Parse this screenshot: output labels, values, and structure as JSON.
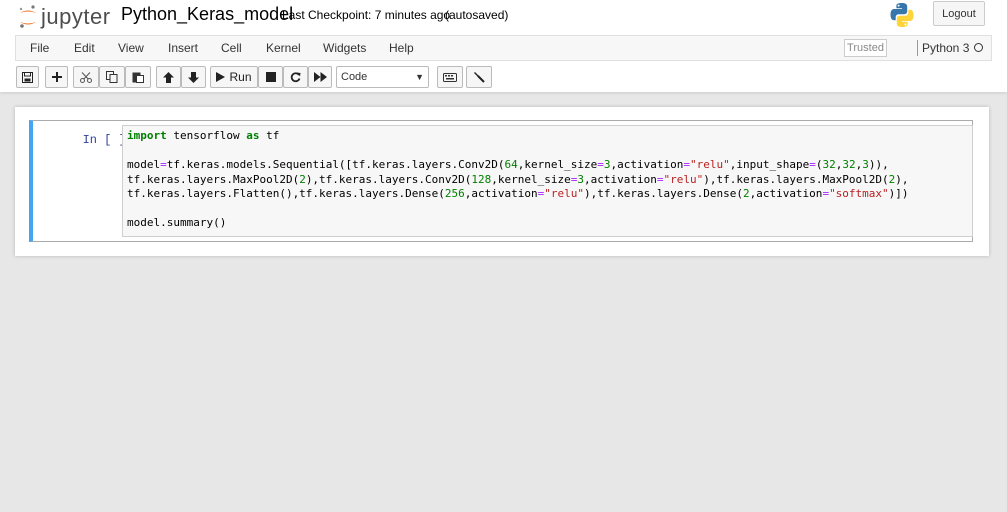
{
  "header": {
    "logo_text": "jupyter",
    "notebook_name": "Python_Keras_model",
    "checkpoint": "Last Checkpoint: 7 minutes ago",
    "autosave": "(autosaved)",
    "logout_label": "Logout"
  },
  "menu": {
    "items": [
      "File",
      "Edit",
      "View",
      "Insert",
      "Cell",
      "Kernel",
      "Widgets",
      "Help"
    ],
    "trusted": "Trusted",
    "kernel": "Python 3"
  },
  "toolbar": {
    "run_label": "Run",
    "cell_type": "Code"
  },
  "cell": {
    "prompt": "In [ ]:",
    "code_lines": [
      "import tensorflow as tf",
      "",
      "model=tf.keras.models.Sequential([tf.keras.layers.Conv2D(64,kernel_size=3,activation=\"relu\",input_shape=(32,32,3)),",
      "tf.keras.layers.MaxPool2D(2),tf.keras.layers.Conv2D(128,kernel_size=3,activation=\"relu\"),tf.keras.layers.MaxPool2D(2),",
      "tf.keras.layers.Flatten(),tf.keras.layers.Dense(256,activation=\"relu\"),tf.keras.layers.Dense(2,activation=\"softmax\")])",
      "",
      "model.summary()"
    ]
  },
  "colors": {
    "cell_selected_border": "#42a5f5",
    "prompt": "#303f9f",
    "keyword": "#008000",
    "string": "#ba2121"
  }
}
